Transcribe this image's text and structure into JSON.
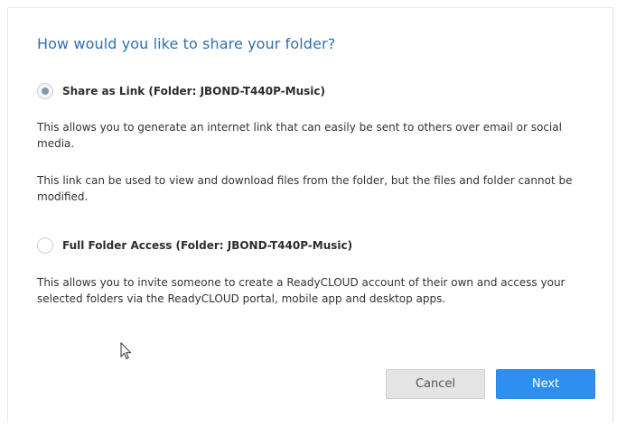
{
  "dialog": {
    "title": "How would you like to share your folder?",
    "options": [
      {
        "label": "Share as Link (Folder: JBOND-T440P-Music)",
        "selected": true,
        "descriptions": [
          "This allows you to generate an internet link that can easily be sent to others over email or social media.",
          "This link can be used to view and download files from the folder, but the files and folder cannot be modified."
        ]
      },
      {
        "label": "Full Folder Access (Folder: JBOND-T440P-Music)",
        "selected": false,
        "descriptions": [
          "This allows you to invite someone to create a ReadyCLOUD account of their own and access your selected folders via the ReadyCLOUD portal, mobile app and desktop apps."
        ]
      }
    ],
    "buttons": {
      "cancel_label": "Cancel",
      "next_label": "Next"
    }
  },
  "colors": {
    "title": "#2f6fb5",
    "primary_button": "#2e8ff0",
    "secondary_button": "#e4e4e4"
  },
  "icons": {
    "cursor": "mouse-pointer-icon"
  }
}
